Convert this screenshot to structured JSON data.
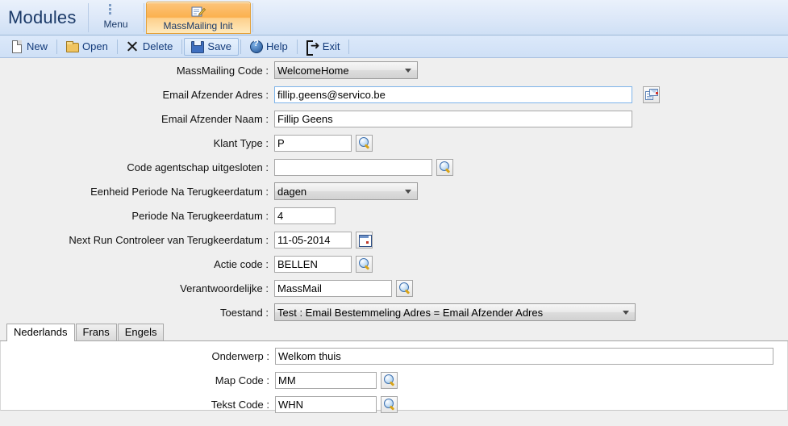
{
  "ribbon": {
    "title": "Modules",
    "buttons": [
      {
        "label": "Menu",
        "icon": "menu-list-icon",
        "active": false
      },
      {
        "label": "MassMailing Init",
        "icon": "edit-document-icon",
        "active": true
      }
    ]
  },
  "toolbar": {
    "items": [
      {
        "label": "New",
        "icon": "new-page-icon",
        "hover": false
      },
      {
        "label": "Open",
        "icon": "open-folder-icon",
        "hover": false
      },
      {
        "label": "Delete",
        "icon": "delete-x-icon",
        "hover": false
      },
      {
        "label": "Save",
        "icon": "save-floppy-icon",
        "hover": true
      },
      {
        "label": "Help",
        "icon": "help-circle-icon",
        "hover": false
      },
      {
        "label": "Exit",
        "icon": "exit-arrow-icon",
        "hover": false
      }
    ]
  },
  "form": {
    "fields": [
      {
        "label": "MassMailing Code :",
        "value": "WelcomeHome"
      },
      {
        "label": "Email Afzender Adres :",
        "value": "fillip.geens@servico.be"
      },
      {
        "label": "Email Afzender Naam :",
        "value": "Fillip Geens"
      },
      {
        "label": "Klant Type :",
        "value": "P"
      },
      {
        "label": "Code agentschap uitgesloten :",
        "value": ""
      },
      {
        "label": "Eenheid Periode Na Terugkeerdatum  :",
        "value": "dagen"
      },
      {
        "label": "Periode Na Terugkeerdatum  :",
        "value": "4"
      },
      {
        "label": "Next Run Controleer van Terugkeerdatum  :",
        "value": "11-05-2014"
      },
      {
        "label": "Actie code :",
        "value": "BELLEN"
      },
      {
        "label": "Verantwoordelijke :",
        "value": "MassMail"
      },
      {
        "label": "Toestand :",
        "value": "Test : Email Bestemmeling Adres = Email Afzender Adres"
      }
    ]
  },
  "tabs": {
    "items": [
      {
        "label": "Nederlands",
        "active": true
      },
      {
        "label": "Frans",
        "active": false
      },
      {
        "label": "Engels",
        "active": false
      }
    ],
    "fields": [
      {
        "label": "Onderwerp :",
        "value": "Welkom thuis"
      },
      {
        "label": "Map Code :",
        "value": "MM"
      },
      {
        "label": "Tekst Code :",
        "value": "WHN"
      }
    ]
  },
  "colors": {
    "ribbon_accent": "#fbb14f",
    "toolbar_text": "#123a7a",
    "background": "#efefef",
    "focus_border": "#7eb4ea"
  }
}
